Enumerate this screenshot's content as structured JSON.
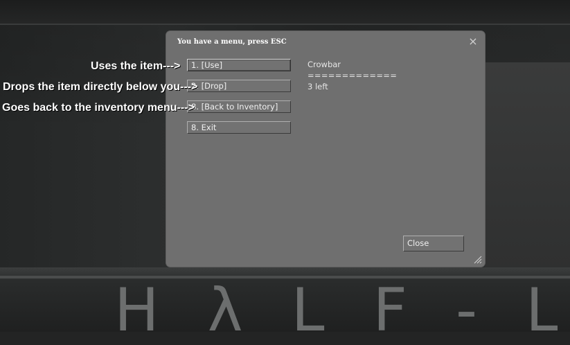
{
  "background": {
    "logo_text": "HλLF-L"
  },
  "annotations": [
    {
      "text": "Uses the item--->"
    },
    {
      "text": "Drops the item directly below you--->"
    },
    {
      "text": "Goes back to the inventory menu--->"
    }
  ],
  "dialog": {
    "title": "You have a menu, press ESC",
    "close_icon": "×",
    "menu_items": [
      {
        "label": "1. [Use]"
      },
      {
        "label": "2. [Drop]"
      },
      {
        "label": "8. [Back to Inventory]"
      },
      {
        "label": "8. Exit"
      }
    ],
    "info": {
      "item_name": "Crowbar",
      "separator": "=============",
      "count_text": "3 left"
    },
    "close_button_label": "Close"
  },
  "colors": {
    "dialog_bg": "#6f6f6f",
    "text": "#f0f0f0",
    "annotation_text": "#ffffff",
    "background": "#232424"
  }
}
